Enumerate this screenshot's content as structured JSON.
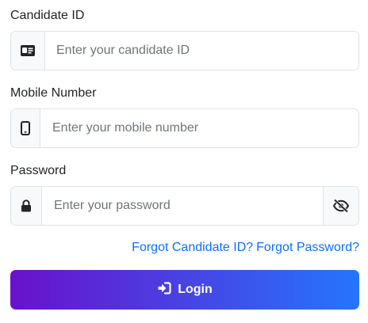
{
  "form": {
    "candidate_id": {
      "label": "Candidate ID",
      "placeholder": "Enter your candidate ID",
      "icon": "id-card-icon"
    },
    "mobile": {
      "label": "Mobile Number",
      "placeholder": "Enter your mobile number",
      "icon": "mobile-phone-icon"
    },
    "password": {
      "label": "Password",
      "placeholder": "Enter your password",
      "icon": "lock-icon",
      "toggle_icon": "eye-slash-icon"
    },
    "links": {
      "forgot_id": "Forgot Candidate ID?",
      "forgot_password": "Forgot Password?"
    },
    "login": {
      "label": "Login",
      "icon": "sign-in-icon"
    }
  },
  "colors": {
    "link": "#0d6efd",
    "gradient_start": "#6a11cb",
    "gradient_end": "#2575fc",
    "border": "#dee2e6",
    "addon_bg": "#f8f9fa"
  }
}
